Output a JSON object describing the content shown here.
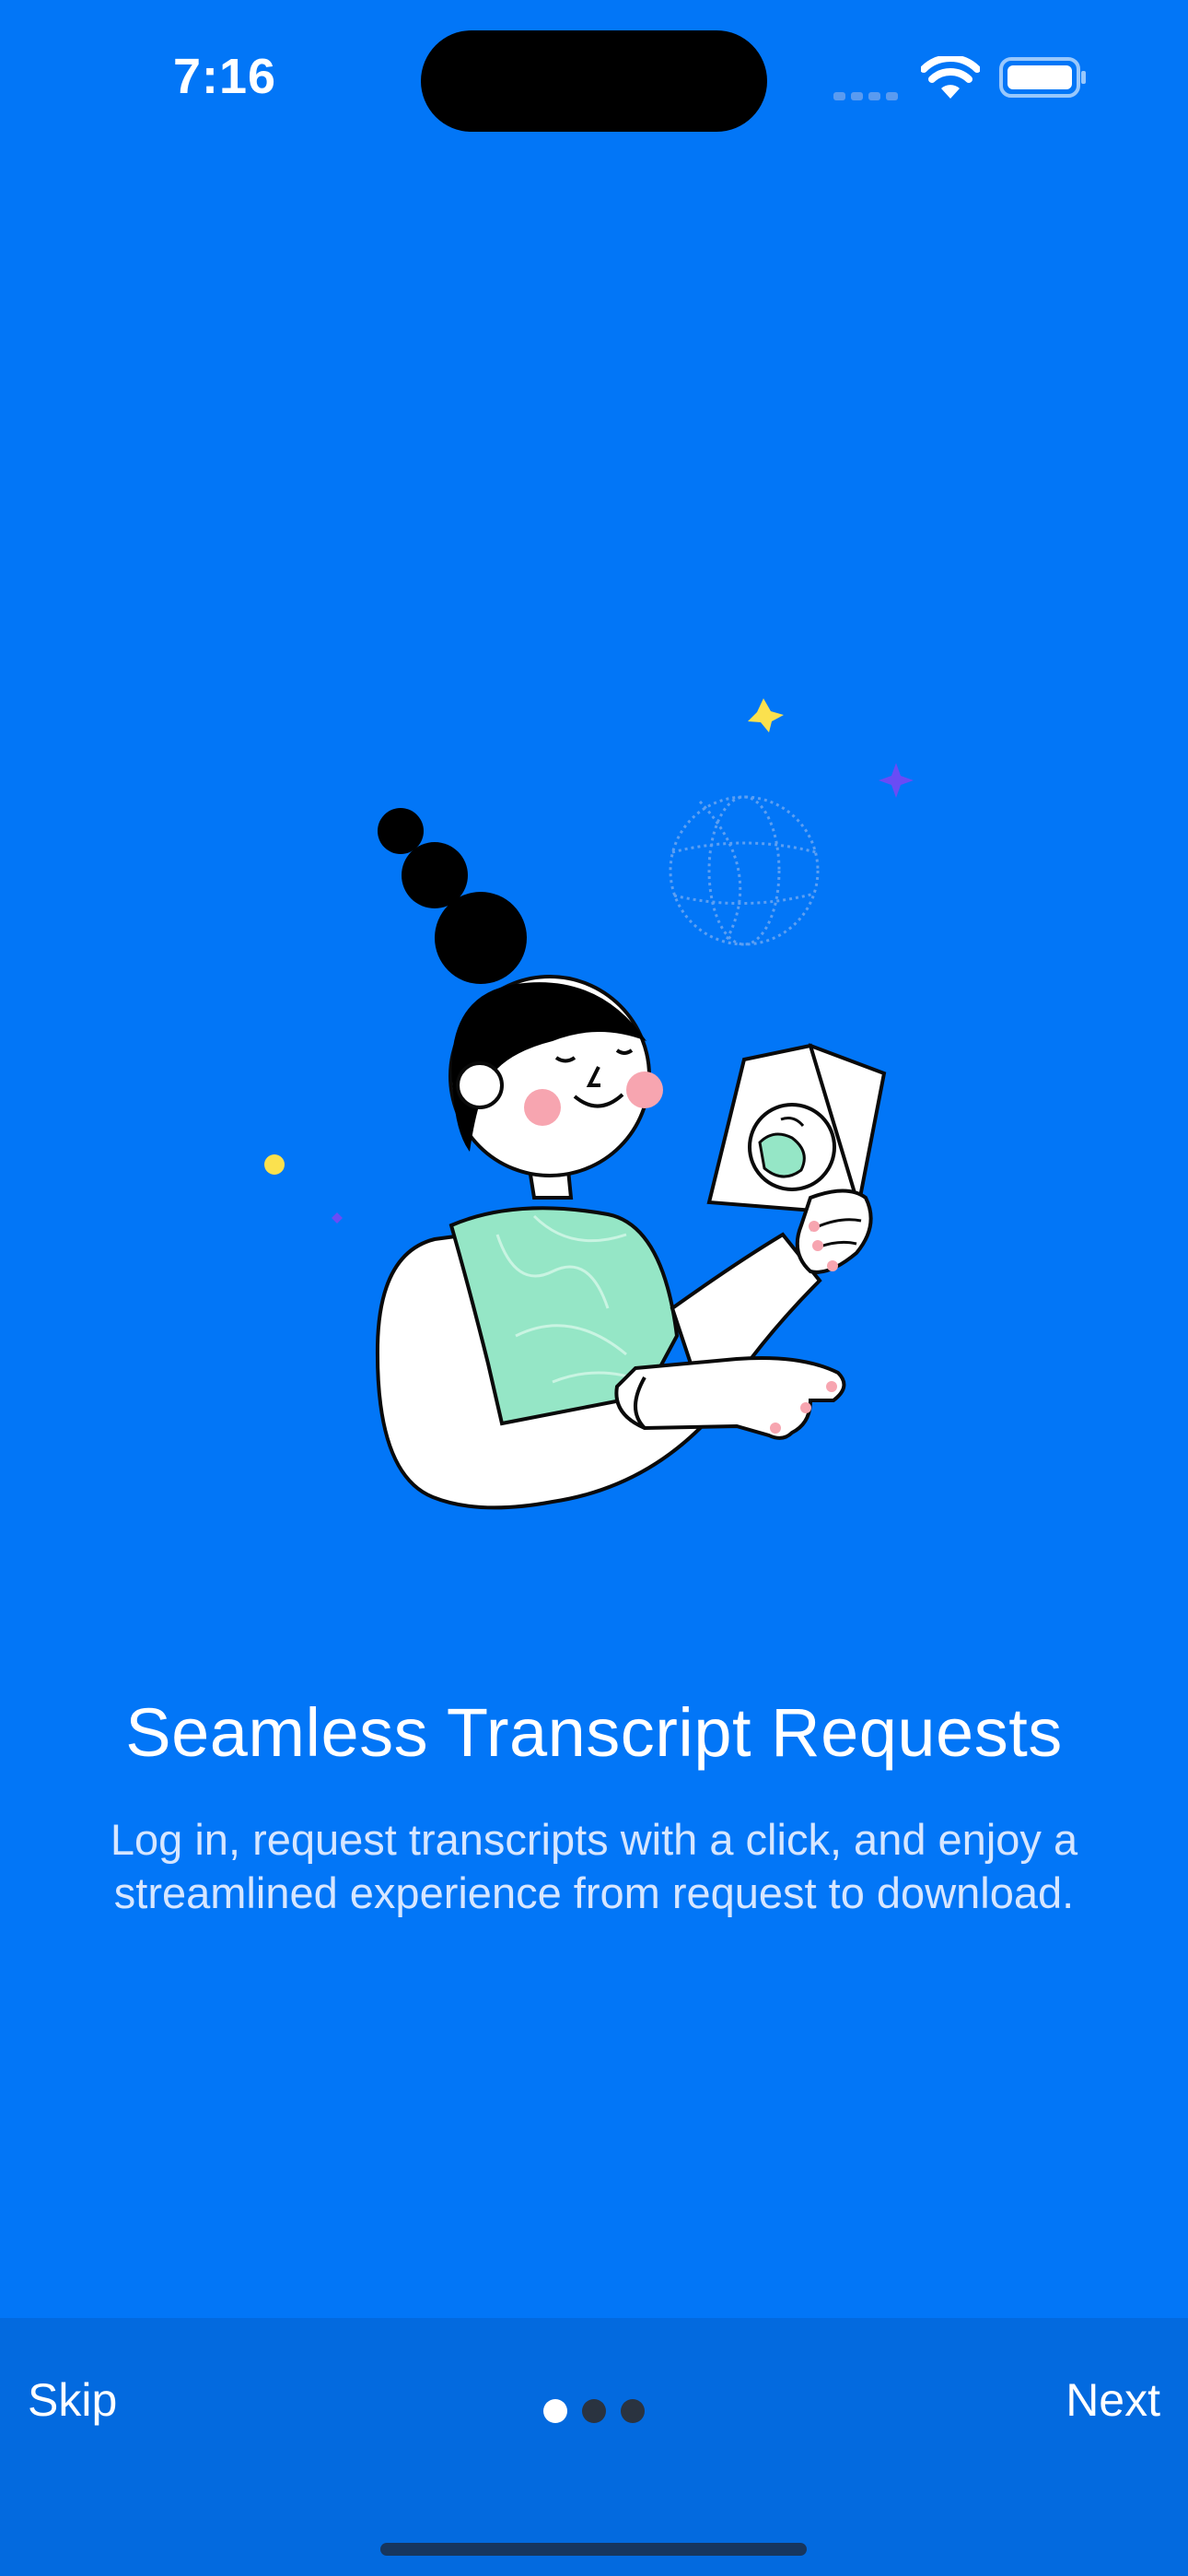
{
  "status_bar": {
    "time": "7:16",
    "icons": [
      "cellular-signal-icon",
      "wifi-icon",
      "battery-icon"
    ]
  },
  "onboarding": {
    "title": "Seamless Transcript Requests",
    "subtitle_line1": "Log in, request transcripts with a click, and enjoy a",
    "subtitle_line2": "streamlined experience from request to download.",
    "illustration": "woman-reading-passport-illustration"
  },
  "footer": {
    "skip_label": "Skip",
    "next_label": "Next",
    "page_count": 3,
    "current_page": 1
  },
  "colors": {
    "background": "#0276f7",
    "footer_background": "#036adf",
    "shirt": "#95e6c6",
    "accent_yellow": "#fbe14e",
    "accent_purple": "#6a4cf5"
  }
}
